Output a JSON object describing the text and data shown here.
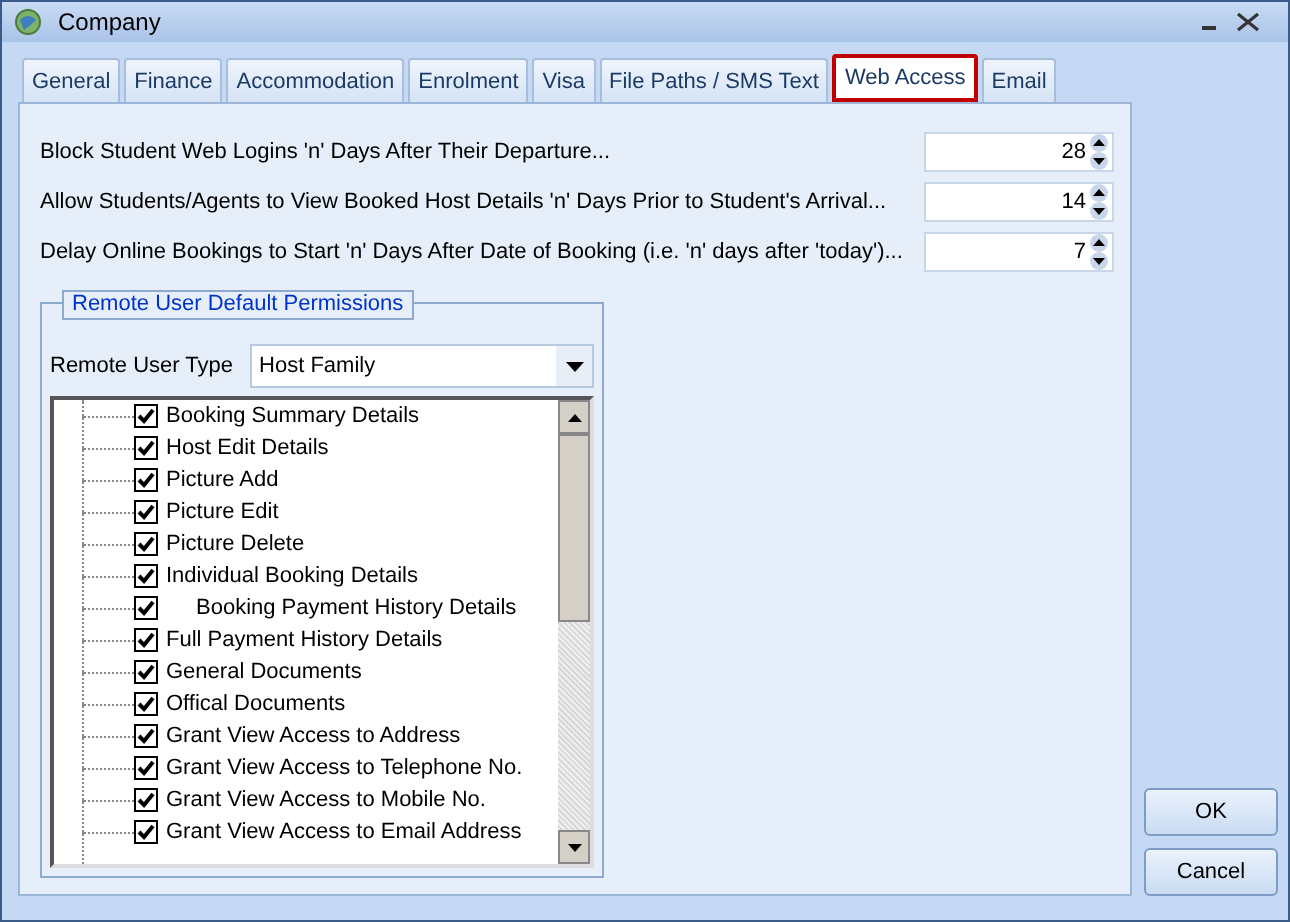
{
  "window": {
    "title": "Company"
  },
  "tabs": [
    {
      "label": "General",
      "selected": false
    },
    {
      "label": "Finance",
      "selected": false
    },
    {
      "label": "Accommodation",
      "selected": false
    },
    {
      "label": "Enrolment",
      "selected": false
    },
    {
      "label": "Visa",
      "selected": false
    },
    {
      "label": "File Paths / SMS Text",
      "selected": false
    },
    {
      "label": "Web Access",
      "selected": true
    },
    {
      "label": "Email",
      "selected": false
    }
  ],
  "settings": [
    {
      "label": "Block Student Web Logins 'n' Days After Their Departure...",
      "value": "28"
    },
    {
      "label": "Allow Students/Agents to View Booked Host Details 'n' Days Prior to Student's Arrival...",
      "value": "14"
    },
    {
      "label": "Delay Online Bookings to Start 'n' Days After Date of Booking (i.e. 'n' days after 'today')...",
      "value": "7"
    }
  ],
  "permissions_group": {
    "title": "Remote User Default Permissions",
    "user_type_label": "Remote User Type",
    "user_type": "Host Family",
    "items": [
      {
        "label": "Booking Summary Details",
        "checked": true,
        "sub_item": false
      },
      {
        "label": "Host Edit Details",
        "checked": true,
        "sub_item": false
      },
      {
        "label": "Picture Add",
        "checked": true,
        "sub_item": false
      },
      {
        "label": "Picture Edit",
        "checked": true,
        "sub_item": false
      },
      {
        "label": "Picture Delete",
        "checked": true,
        "sub_item": false
      },
      {
        "label": "Individual Booking Details",
        "checked": true,
        "sub_item": false
      },
      {
        "label": "Booking Payment History Details",
        "checked": true,
        "sub_item": true
      },
      {
        "label": "Full Payment History Details",
        "checked": true,
        "sub_item": false
      },
      {
        "label": "General Documents",
        "checked": true,
        "sub_item": false
      },
      {
        "label": "Offical Documents",
        "checked": true,
        "sub_item": false
      },
      {
        "label": "Grant View Access to Address",
        "checked": true,
        "sub_item": false
      },
      {
        "label": "Grant View Access to Telephone No.",
        "checked": true,
        "sub_item": false
      },
      {
        "label": "Grant View Access to Mobile No.",
        "checked": true,
        "sub_item": false
      },
      {
        "label": "Grant View Access to Email Address",
        "checked": true,
        "sub_item": false
      }
    ]
  },
  "buttons": [
    "OK",
    "Cancel"
  ]
}
